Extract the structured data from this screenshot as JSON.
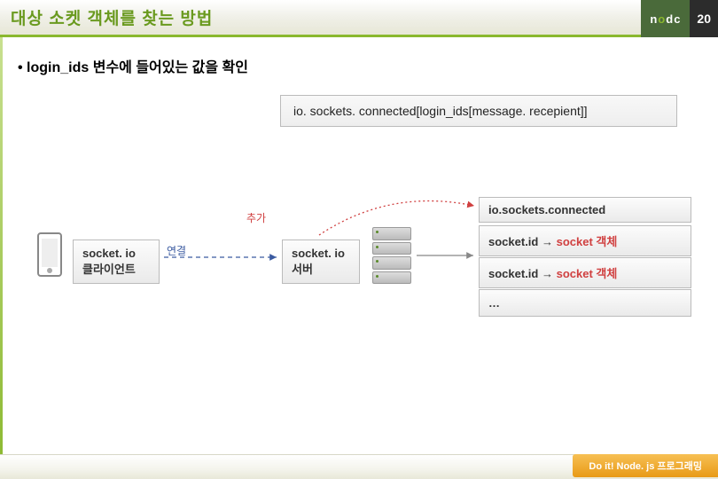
{
  "header": {
    "title": "대상 소켓 객체를 찾는 방법",
    "logo_prefix": "n",
    "logo_o": "o",
    "logo_rest": "dc",
    "page_number": "20"
  },
  "bullet": "• login_ids 변수에 들어있는 값을 확인",
  "code": "io. sockets. connected[login_ids[message. recepient]]",
  "diagram": {
    "label_add": "추가",
    "label_connect": "연결",
    "connected_header": "io.sockets.connected",
    "client_line1": "socket. io",
    "client_line2": "클라이언트",
    "server_line1": "socket. io",
    "server_line2": "서버",
    "map1_key": "socket.id",
    "map1_arrow": "→",
    "map1_val": "socket 객체",
    "map2_key": "socket.id",
    "map2_arrow": "→",
    "map2_val": "socket 객체",
    "map3": "…"
  },
  "footer": {
    "badge": "Do it! Node. js 프로그래밍"
  }
}
